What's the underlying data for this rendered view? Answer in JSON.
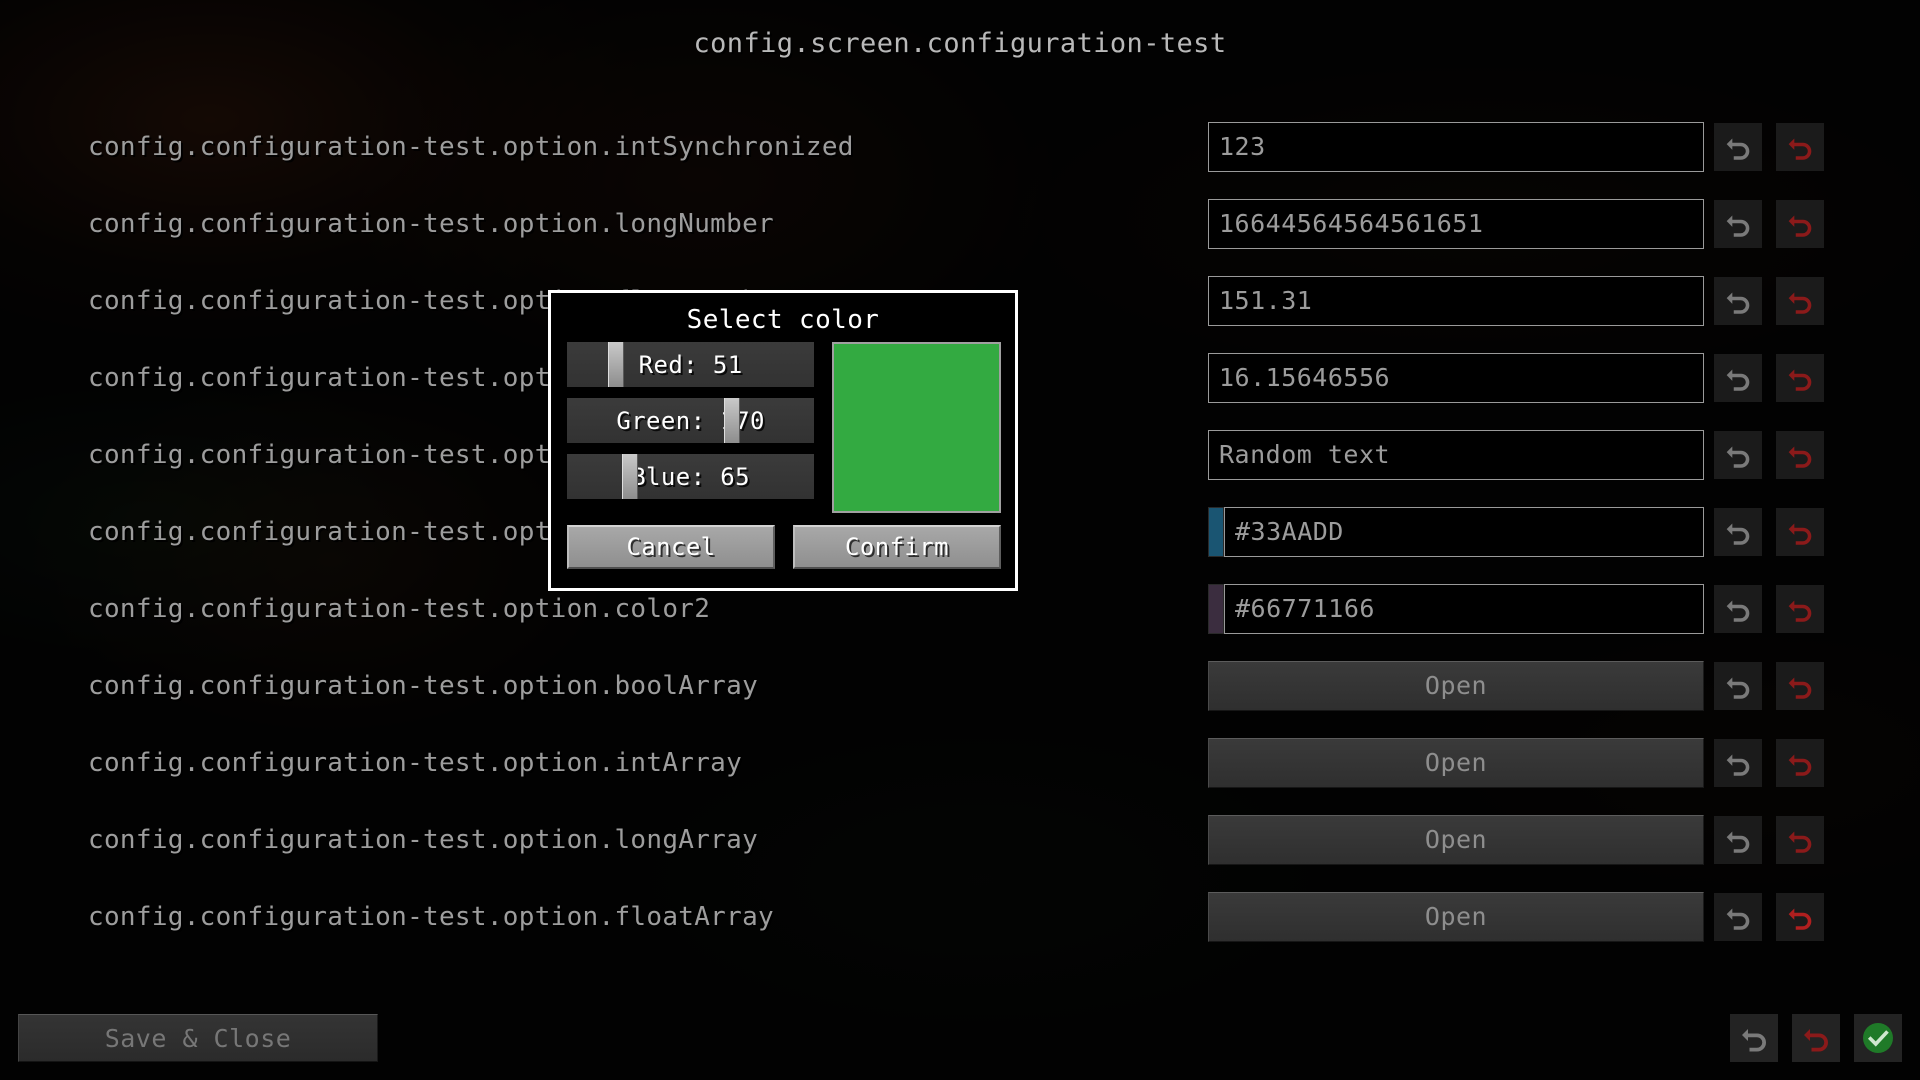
{
  "screen": {
    "title": "config.screen.configuration-test"
  },
  "rows": [
    {
      "label": "config.configuration-test.option.intSynchronized",
      "control": "text",
      "value": "123",
      "reset_gray_icon": "undo-icon",
      "reset_red_icon": "undo-icon"
    },
    {
      "label": "config.configuration-test.option.longNumber",
      "control": "text",
      "value": "16644564564561651",
      "reset_gray_icon": "undo-icon",
      "reset_red_icon": "undo-icon"
    },
    {
      "label": "config.configuration-test.option.floatNumber",
      "control": "text",
      "value": "151.31",
      "reset_gray_icon": "undo-icon",
      "reset_red_icon": "undo-icon"
    },
    {
      "label": "config.configuration-test.option.doubleNumber",
      "control": "text",
      "value": "16.15646556",
      "reset_gray_icon": "undo-icon",
      "reset_red_icon": "undo-icon"
    },
    {
      "label": "config.configuration-test.option.string",
      "control": "text",
      "value": "Random text",
      "reset_gray_icon": "undo-icon",
      "reset_red_icon": "undo-icon"
    },
    {
      "label": "config.configuration-test.option.color",
      "control": "color",
      "value": "#33AADD",
      "chip_color": "#1a5572",
      "reset_gray_icon": "undo-icon",
      "reset_red_icon": "undo-icon"
    },
    {
      "label": "config.configuration-test.option.color2",
      "control": "color",
      "value": "#66771166",
      "chip_color": "#3b2d3f",
      "reset_gray_icon": "undo-icon",
      "reset_red_icon": "undo-icon"
    },
    {
      "label": "config.configuration-test.option.boolArray",
      "control": "button",
      "value": "Open",
      "reset_gray_icon": "undo-icon",
      "reset_red_icon": "undo-icon"
    },
    {
      "label": "config.configuration-test.option.intArray",
      "control": "button",
      "value": "Open",
      "reset_gray_icon": "undo-icon",
      "reset_red_icon": "undo-icon"
    },
    {
      "label": "config.configuration-test.option.longArray",
      "control": "button",
      "value": "Open",
      "reset_gray_icon": "undo-icon",
      "reset_red_icon": "undo-icon"
    },
    {
      "label": "config.configuration-test.option.floatArray",
      "control": "button",
      "value": "Open",
      "reset_gray_icon": "undo-icon",
      "reset_red_icon": "undo-icon"
    }
  ],
  "bottom_bar": {
    "save_close_label": "Save & Close",
    "undo_gray_icon": "undo-icon",
    "undo_red_icon": "undo-icon",
    "confirm_icon": "check-circle-icon"
  },
  "dialog": {
    "title": "Select color",
    "sliders": [
      {
        "label": "Red: 51",
        "value": 51,
        "handle_pct": 20
      },
      {
        "label": "Green: 170",
        "value": 170,
        "handle_pct": 66.7
      },
      {
        "label": "Blue: 65",
        "value": 65,
        "handle_pct": 25.5
      }
    ],
    "preview_color": "#33AA41",
    "cancel_label": "Cancel",
    "confirm_label": "Confirm"
  },
  "colors": {
    "dialog_border": "#ffffff",
    "reset_red": "#8b1a1a",
    "reset_red_active": "#b01f1f",
    "reset_gray": "#7a7a7a",
    "confirm_green": "#1f7a28"
  }
}
